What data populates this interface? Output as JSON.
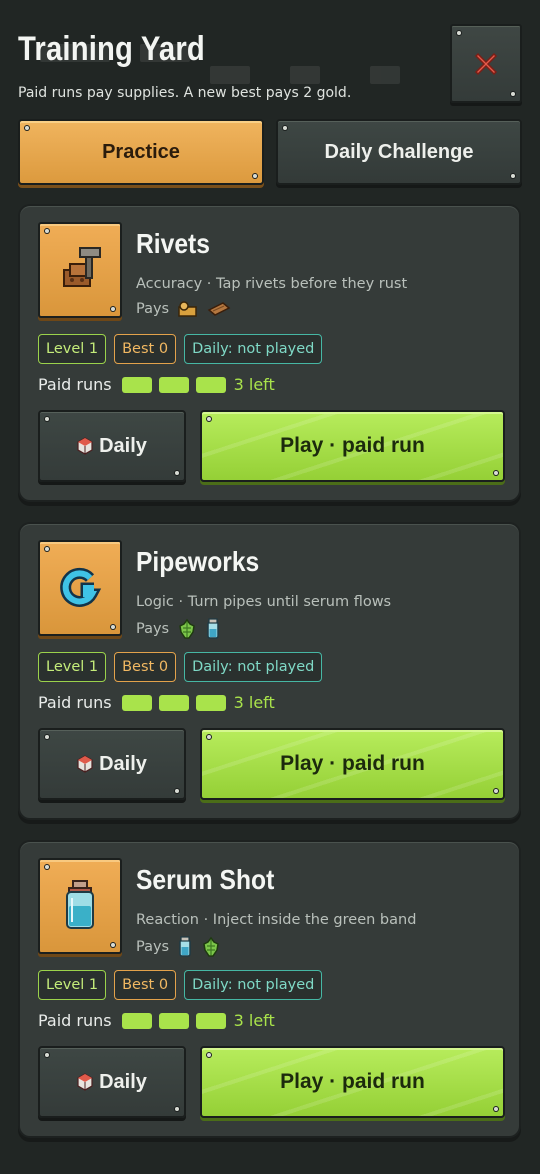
{
  "header": {
    "title": "Training Yard",
    "subtitle": "Paid runs pay supplies. A new best pays 2 gold.",
    "close_icon": "close-x-icon"
  },
  "tabs": [
    {
      "label": "Practice",
      "active": true
    },
    {
      "label": "Daily Challenge",
      "active": false
    }
  ],
  "colors": {
    "accent_orange": "#e8a54c",
    "accent_green": "#a9e34b",
    "teal": "#46b7a4",
    "panel": "#353b39",
    "background": "#212624"
  },
  "games": [
    {
      "icon": "rivet-hammer-icon",
      "title": "Rivets",
      "description": "Accuracy · Tap rivets before they rust",
      "pays_label": "Pays",
      "pays_icons": [
        "gear-scrap-icon",
        "plank-icon"
      ],
      "level": "Level 1",
      "best": "Best 0",
      "daily": "Daily: not played",
      "paid_runs_label": "Paid runs",
      "runs_remaining": 3,
      "runs_left": "3 left",
      "daily_button": "Daily",
      "play_button": "Play · paid run"
    },
    {
      "icon": "pipe-loop-icon",
      "title": "Pipeworks",
      "description": "Logic · Turn pipes until serum flows",
      "pays_label": "Pays",
      "pays_icons": [
        "herb-bundle-icon",
        "serum-vial-icon"
      ],
      "level": "Level 1",
      "best": "Best 0",
      "daily": "Daily: not played",
      "paid_runs_label": "Paid runs",
      "runs_remaining": 3,
      "runs_left": "3 left",
      "daily_button": "Daily",
      "play_button": "Play · paid run"
    },
    {
      "icon": "serum-jar-icon",
      "title": "Serum Shot",
      "description": "Reaction · Inject inside the green band",
      "pays_label": "Pays",
      "pays_icons": [
        "serum-vial-icon",
        "herb-bundle-icon"
      ],
      "level": "Level 1",
      "best": "Best 0",
      "daily": "Daily: not played",
      "paid_runs_label": "Paid runs",
      "runs_remaining": 3,
      "runs_left": "3 left",
      "daily_button": "Daily",
      "play_button": "Play · paid run"
    }
  ]
}
